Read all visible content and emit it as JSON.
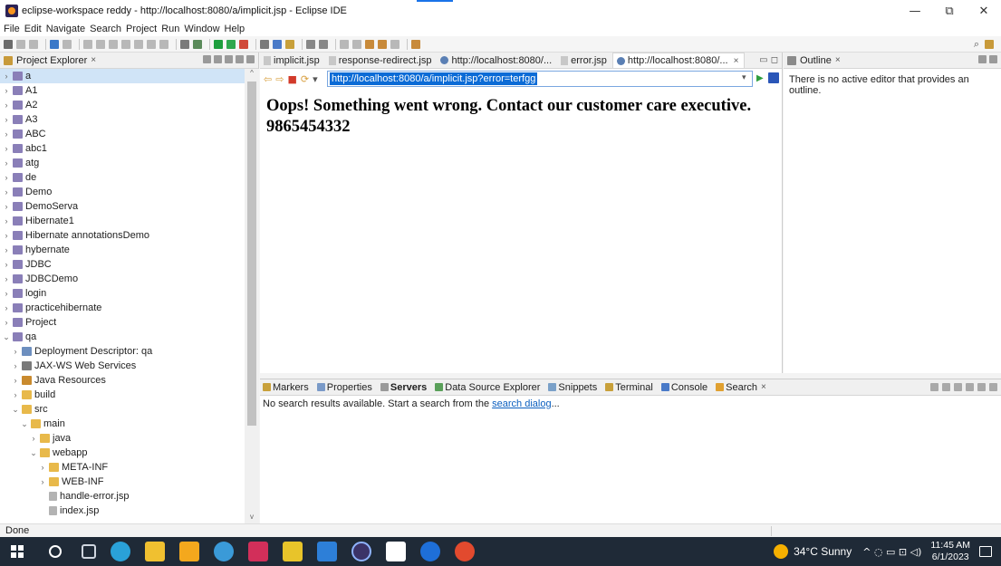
{
  "window": {
    "title": "eclipse-workspace reddy - http://localhost:8080/a/implicit.jsp - Eclipse IDE",
    "controls": {
      "minimize": "—",
      "restore": "⧉",
      "close": "✕"
    }
  },
  "menu": [
    "File",
    "Edit",
    "Navigate",
    "Search",
    "Project",
    "Run",
    "Window",
    "Help"
  ],
  "project_explorer": {
    "title": "Project Explorer",
    "tree": [
      {
        "label": "a",
        "icon": "project-icon",
        "level": 0,
        "chevron": "›",
        "selected": true
      },
      {
        "label": "A1",
        "icon": "project-icon",
        "level": 0,
        "chevron": "›"
      },
      {
        "label": "A2",
        "icon": "project-icon",
        "level": 0,
        "chevron": "›"
      },
      {
        "label": "A3",
        "icon": "project-icon",
        "level": 0,
        "chevron": "›"
      },
      {
        "label": "ABC",
        "icon": "project-icon",
        "level": 0,
        "chevron": "›"
      },
      {
        "label": "abc1",
        "icon": "project-icon",
        "level": 0,
        "chevron": "›"
      },
      {
        "label": "atg",
        "icon": "project-icon",
        "level": 0,
        "chevron": "›"
      },
      {
        "label": "de",
        "icon": "project-icon",
        "level": 0,
        "chevron": "›"
      },
      {
        "label": "Demo",
        "icon": "project-icon",
        "level": 0,
        "chevron": "›"
      },
      {
        "label": "DemoServa",
        "icon": "project-icon",
        "level": 0,
        "chevron": "›"
      },
      {
        "label": "Hibernate1",
        "icon": "project-icon",
        "level": 0,
        "chevron": "›"
      },
      {
        "label": "Hibernate annotationsDemo",
        "icon": "project-icon",
        "level": 0,
        "chevron": "›"
      },
      {
        "label": "hybernate",
        "icon": "project-icon",
        "level": 0,
        "chevron": "›"
      },
      {
        "label": "JDBC",
        "icon": "project-icon",
        "level": 0,
        "chevron": "›"
      },
      {
        "label": "JDBCDemo",
        "icon": "project-icon",
        "level": 0,
        "chevron": "›"
      },
      {
        "label": "login",
        "icon": "project-icon",
        "level": 0,
        "chevron": "›"
      },
      {
        "label": "practicehibernate",
        "icon": "project-icon",
        "level": 0,
        "chevron": "›"
      },
      {
        "label": "Project",
        "icon": "project-icon",
        "level": 0,
        "chevron": "›"
      },
      {
        "label": "qa",
        "icon": "project-icon",
        "level": 0,
        "chevron": "⌄"
      },
      {
        "label": "Deployment Descriptor: qa",
        "icon": "descriptor-icon",
        "level": 1,
        "chevron": "›"
      },
      {
        "label": "JAX-WS Web Services",
        "icon": "webservices-icon",
        "level": 1,
        "chevron": "›"
      },
      {
        "label": "Java Resources",
        "icon": "java-resources-icon",
        "level": 1,
        "chevron": "›"
      },
      {
        "label": "build",
        "icon": "folder-icon",
        "level": 1,
        "chevron": "›"
      },
      {
        "label": "src",
        "icon": "folder-icon",
        "level": 1,
        "chevron": "⌄"
      },
      {
        "label": "main",
        "icon": "folder-icon",
        "level": 2,
        "chevron": "⌄"
      },
      {
        "label": "java",
        "icon": "folder-icon",
        "level": 3,
        "chevron": "›"
      },
      {
        "label": "webapp",
        "icon": "folder-icon",
        "level": 3,
        "chevron": "⌄"
      },
      {
        "label": "META-INF",
        "icon": "folder-icon",
        "level": 4,
        "chevron": "›"
      },
      {
        "label": "WEB-INF",
        "icon": "folder-icon",
        "level": 4,
        "chevron": "›"
      },
      {
        "label": "handle-error.jsp",
        "icon": "jsp-file-icon",
        "level": 4,
        "chevron": ""
      },
      {
        "label": "index.jsp",
        "icon": "jsp-file-icon",
        "level": 4,
        "chevron": ""
      }
    ]
  },
  "editor": {
    "tabs": [
      {
        "label": "implicit.jsp",
        "icon": "file-icon"
      },
      {
        "label": "response-redirect.jsp",
        "icon": "file-icon"
      },
      {
        "label": "http://localhost:8080/...",
        "icon": "globe-icon"
      },
      {
        "label": "error.jsp",
        "icon": "file-icon"
      },
      {
        "label": "http://localhost:8080/...",
        "icon": "globe-icon",
        "active": true,
        "close": "×"
      }
    ],
    "url": "http://localhost:8080/a/implicit.jsp?error=terfgg",
    "page_message": "Oops! Something went wrong. Contact our customer care executive. 9865454332"
  },
  "outline": {
    "title": "Outline",
    "message": "There is no active editor that provides an outline."
  },
  "bottom_panel": {
    "tabs": [
      {
        "label": "Markers"
      },
      {
        "label": "Properties"
      },
      {
        "label": "Servers",
        "bold": true
      },
      {
        "label": "Data Source Explorer"
      },
      {
        "label": "Snippets"
      },
      {
        "label": "Terminal"
      },
      {
        "label": "Console"
      },
      {
        "label": "Search",
        "close": "×"
      }
    ],
    "message_prefix": "No search results available. Start a search from the ",
    "message_link": "search dialog",
    "message_suffix": "..."
  },
  "status": {
    "text": "Done"
  },
  "taskbar": {
    "weather": "34°C Sunny",
    "time": "11:45 AM",
    "date": "6/1/2023"
  },
  "colors": {
    "url_highlight": "#0b6bd6",
    "selection": "#d0e4f7",
    "taskbar": "#1f2a37",
    "link": "#0b5fbf"
  }
}
